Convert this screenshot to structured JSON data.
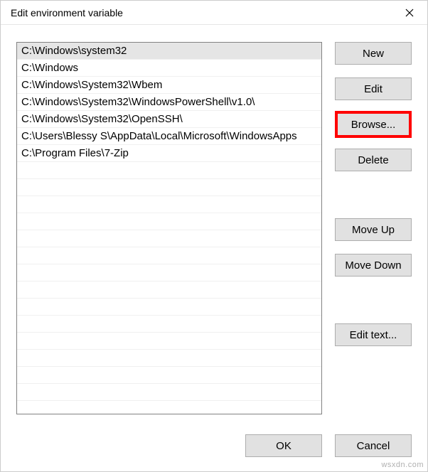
{
  "title": "Edit environment variable",
  "list": {
    "items": [
      "C:\\Windows\\system32",
      "C:\\Windows",
      "C:\\Windows\\System32\\Wbem",
      "C:\\Windows\\System32\\WindowsPowerShell\\v1.0\\",
      "C:\\Windows\\System32\\OpenSSH\\",
      "C:\\Users\\Blessy S\\AppData\\Local\\Microsoft\\WindowsApps",
      "C:\\Program Files\\7-Zip"
    ],
    "selected_index": 0
  },
  "buttons": {
    "new": "New",
    "edit": "Edit",
    "browse": "Browse...",
    "delete": "Delete",
    "move_up": "Move Up",
    "move_down": "Move Down",
    "edit_text": "Edit text..."
  },
  "footer": {
    "ok": "OK",
    "cancel": "Cancel"
  },
  "watermark": "wsxdn.com"
}
